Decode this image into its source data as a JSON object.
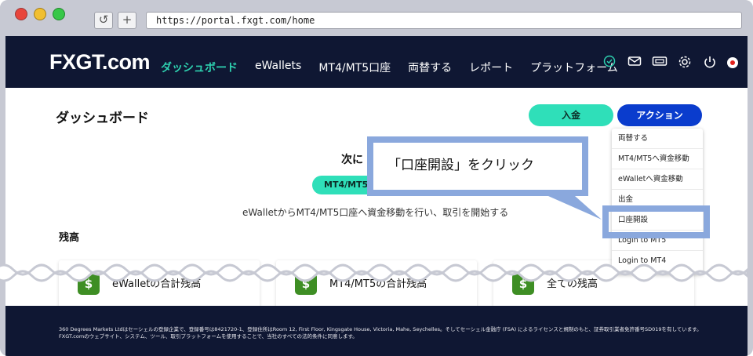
{
  "browser": {
    "url": "https://portal.fxgt.com/home",
    "reload_icon": "↺",
    "newtab_icon": "+"
  },
  "header": {
    "logo_text": "FXGT.com",
    "menu": [
      {
        "label": "ダッシュボード",
        "active": true
      },
      {
        "label": "eWallets"
      },
      {
        "label": "MT4/MT5口座"
      },
      {
        "label": "両替する"
      },
      {
        "label": "レポート"
      },
      {
        "label": "プラットフォーム"
      }
    ],
    "icons": {
      "check": "check-circle-icon",
      "mail": "mail-icon",
      "ticket": "ticket-icon",
      "gear": "gear-icon",
      "power": "power-icon",
      "flag": "japan-flag-icon"
    }
  },
  "main": {
    "page_title": "ダッシュボード",
    "deposit_button": "入金",
    "action_button": "アクション",
    "next_title": "次に",
    "mt_pill": "MT4/MT5",
    "sub_text": "eWalletからMT4/MT5口座へ資金移動を行い、取引を開始する",
    "balance_title": "残高",
    "cards": [
      {
        "label": "eWalletの合計残高",
        "icon": "$"
      },
      {
        "label": "MT4/MT5の合計残高",
        "icon": "$"
      },
      {
        "label": "全ての残高",
        "icon": "$"
      }
    ]
  },
  "dropdown": {
    "items": [
      "両替する",
      "MT4/MT5へ資金移動",
      "eWalletへ資金移動",
      "出金",
      "口座開設",
      "Login to MT5",
      "Login to MT4"
    ]
  },
  "callout": {
    "text": "「口座開設」をクリック",
    "color": "#8aa8dd"
  },
  "footer": {
    "text": "360 Degrees Markets Ltdはセーシェルの登録企業で、登録番号は8421720-1、登録住所はRoom 12, First Floor, Kingsgate House, Victoria, Mahe, Seychelles。そしてセーシェル金融庁 (FSA) によるライセンスと規制のもと、証券取引業者免許番号SD019を有しています。FXGT.comのウェブサイト、システム、ツール、取引プラットフォームを使用することで、当社のすべての法的条件に同意します。"
  },
  "colors": {
    "navy": "#0f1733",
    "teal": "#2fdfb9",
    "blue": "#0a3ccd",
    "green": "#3e8e24"
  }
}
